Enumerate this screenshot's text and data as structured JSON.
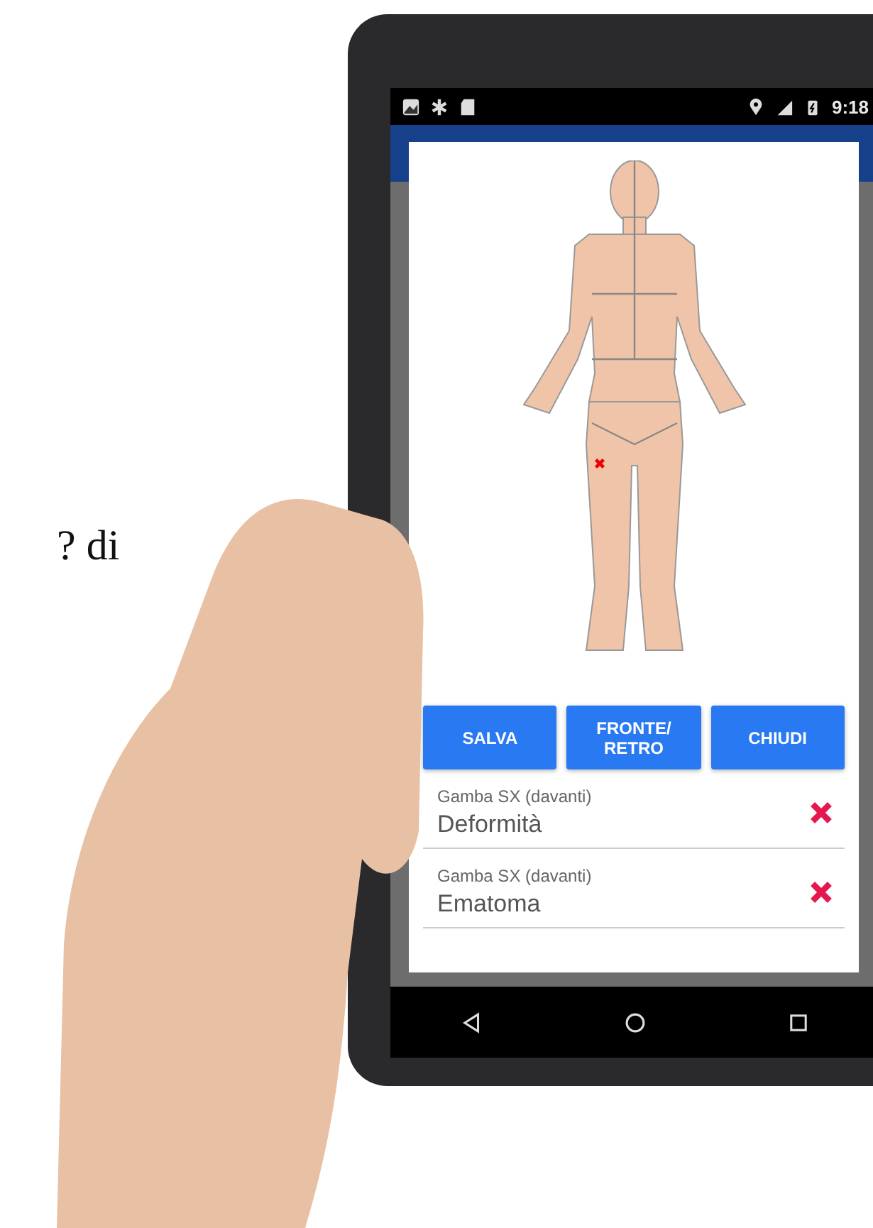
{
  "side_text": "? di",
  "status_bar": {
    "time": "9:18"
  },
  "dialog": {
    "buttons": [
      {
        "label": "SALVA"
      },
      {
        "label": "FRONTE/\nRETRO"
      },
      {
        "label": "CHIUDI"
      }
    ],
    "findings": [
      {
        "area": "Gamba SX (davanti)",
        "finding": "Deformità"
      },
      {
        "area": "Gamba SX (davanti)",
        "finding": "Ematoma"
      }
    ]
  }
}
